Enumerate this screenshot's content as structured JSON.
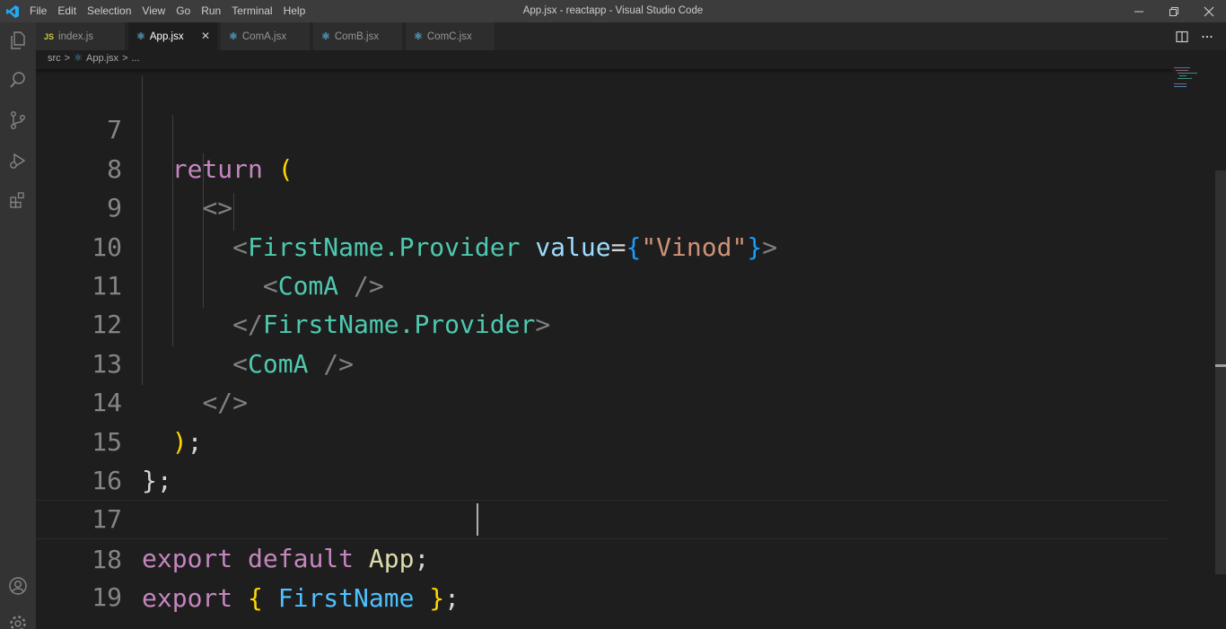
{
  "window": {
    "title": "App.jsx - reactapp - Visual Studio Code",
    "menu": [
      "File",
      "Edit",
      "Selection",
      "View",
      "Go",
      "Run",
      "Terminal",
      "Help"
    ]
  },
  "tabs": [
    {
      "label": "index.js",
      "icon": "JS",
      "active": false
    },
    {
      "label": "App.jsx",
      "icon": "react-icon",
      "active": true,
      "close": "✕"
    },
    {
      "label": "ComA.jsx",
      "icon": "react-icon",
      "active": false
    },
    {
      "label": "ComB.jsx",
      "icon": "react-icon",
      "active": false
    },
    {
      "label": "ComC.jsx",
      "icon": "react-icon",
      "active": false
    }
  ],
  "breadcrumb": {
    "folder": "src",
    "sep": ">",
    "file": "App.jsx",
    "sep2": ">",
    "more": "..."
  },
  "editor": {
    "lines": [
      {
        "n": "7"
      },
      {
        "n": "8"
      },
      {
        "n": "9"
      },
      {
        "n": "10"
      },
      {
        "n": "11"
      },
      {
        "n": "12"
      },
      {
        "n": "13"
      },
      {
        "n": "14"
      },
      {
        "n": "15"
      },
      {
        "n": "16"
      },
      {
        "n": "17"
      },
      {
        "n": "18"
      },
      {
        "n": "19"
      }
    ],
    "code": {
      "l7_return": "return",
      "l7_paren": "(",
      "l8_frag": "<>",
      "l9_lt": "<",
      "l9_tag": "FirstName.Provider",
      "l9_attr": "value",
      "l9_eq": "=",
      "l9_ob": "{",
      "l9_str": "\"Vinod\"",
      "l9_cb": "}",
      "l9_gt": ">",
      "l10_lt": "<",
      "l10_tag": "ComA",
      "l10_end": "/>",
      "l11_lt": "</",
      "l11_tag": "FirstName.Provider",
      "l11_gt": ">",
      "l12_lt": "<",
      "l12_tag": "ComA",
      "l12_end": "/>",
      "l13_frag": "</>",
      "l14_paren": ")",
      "l14_semi": ";",
      "l15_brace": "}",
      "l15_semi": ";",
      "l17_export": "export",
      "l17_default": "default",
      "l17_app": "App",
      "l17_semi": ";",
      "l18_export": "export",
      "l18_ob": "{",
      "l18_name": "FirstName",
      "l18_cb": "}",
      "l18_semi": ";"
    }
  },
  "colors": {
    "keyword": "#c586c0",
    "tag": "#4ec9b0",
    "attribute": "#9cdcfe",
    "string": "#ce9178",
    "background": "#1e1e1e"
  }
}
